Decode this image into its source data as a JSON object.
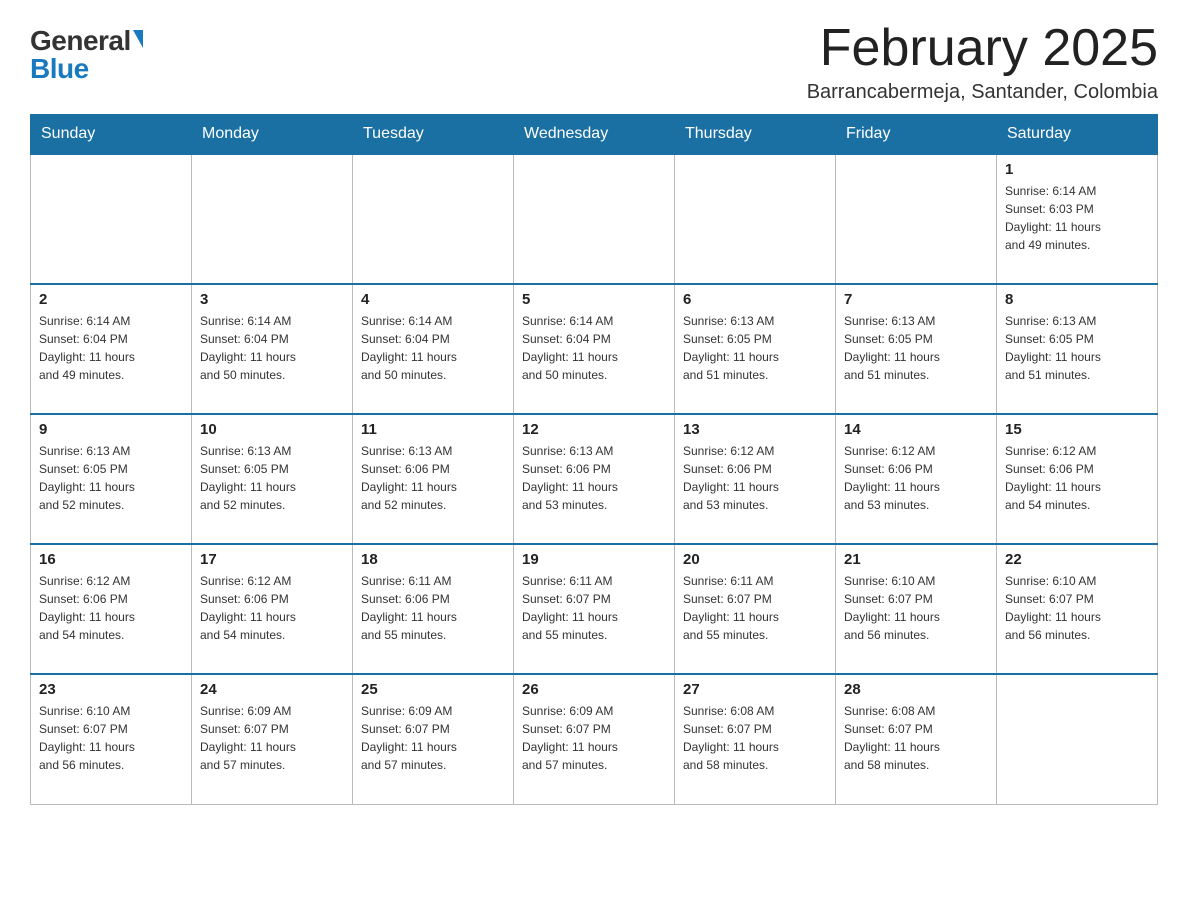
{
  "header": {
    "logo_general": "General",
    "logo_blue": "Blue",
    "title": "February 2025",
    "location": "Barrancabermeja, Santander, Colombia"
  },
  "calendar": {
    "days_of_week": [
      "Sunday",
      "Monday",
      "Tuesday",
      "Wednesday",
      "Thursday",
      "Friday",
      "Saturday"
    ],
    "weeks": [
      [
        {
          "day": "",
          "info": ""
        },
        {
          "day": "",
          "info": ""
        },
        {
          "day": "",
          "info": ""
        },
        {
          "day": "",
          "info": ""
        },
        {
          "day": "",
          "info": ""
        },
        {
          "day": "",
          "info": ""
        },
        {
          "day": "1",
          "info": "Sunrise: 6:14 AM\nSunset: 6:03 PM\nDaylight: 11 hours\nand 49 minutes."
        }
      ],
      [
        {
          "day": "2",
          "info": "Sunrise: 6:14 AM\nSunset: 6:04 PM\nDaylight: 11 hours\nand 49 minutes."
        },
        {
          "day": "3",
          "info": "Sunrise: 6:14 AM\nSunset: 6:04 PM\nDaylight: 11 hours\nand 50 minutes."
        },
        {
          "day": "4",
          "info": "Sunrise: 6:14 AM\nSunset: 6:04 PM\nDaylight: 11 hours\nand 50 minutes."
        },
        {
          "day": "5",
          "info": "Sunrise: 6:14 AM\nSunset: 6:04 PM\nDaylight: 11 hours\nand 50 minutes."
        },
        {
          "day": "6",
          "info": "Sunrise: 6:13 AM\nSunset: 6:05 PM\nDaylight: 11 hours\nand 51 minutes."
        },
        {
          "day": "7",
          "info": "Sunrise: 6:13 AM\nSunset: 6:05 PM\nDaylight: 11 hours\nand 51 minutes."
        },
        {
          "day": "8",
          "info": "Sunrise: 6:13 AM\nSunset: 6:05 PM\nDaylight: 11 hours\nand 51 minutes."
        }
      ],
      [
        {
          "day": "9",
          "info": "Sunrise: 6:13 AM\nSunset: 6:05 PM\nDaylight: 11 hours\nand 52 minutes."
        },
        {
          "day": "10",
          "info": "Sunrise: 6:13 AM\nSunset: 6:05 PM\nDaylight: 11 hours\nand 52 minutes."
        },
        {
          "day": "11",
          "info": "Sunrise: 6:13 AM\nSunset: 6:06 PM\nDaylight: 11 hours\nand 52 minutes."
        },
        {
          "day": "12",
          "info": "Sunrise: 6:13 AM\nSunset: 6:06 PM\nDaylight: 11 hours\nand 53 minutes."
        },
        {
          "day": "13",
          "info": "Sunrise: 6:12 AM\nSunset: 6:06 PM\nDaylight: 11 hours\nand 53 minutes."
        },
        {
          "day": "14",
          "info": "Sunrise: 6:12 AM\nSunset: 6:06 PM\nDaylight: 11 hours\nand 53 minutes."
        },
        {
          "day": "15",
          "info": "Sunrise: 6:12 AM\nSunset: 6:06 PM\nDaylight: 11 hours\nand 54 minutes."
        }
      ],
      [
        {
          "day": "16",
          "info": "Sunrise: 6:12 AM\nSunset: 6:06 PM\nDaylight: 11 hours\nand 54 minutes."
        },
        {
          "day": "17",
          "info": "Sunrise: 6:12 AM\nSunset: 6:06 PM\nDaylight: 11 hours\nand 54 minutes."
        },
        {
          "day": "18",
          "info": "Sunrise: 6:11 AM\nSunset: 6:06 PM\nDaylight: 11 hours\nand 55 minutes."
        },
        {
          "day": "19",
          "info": "Sunrise: 6:11 AM\nSunset: 6:07 PM\nDaylight: 11 hours\nand 55 minutes."
        },
        {
          "day": "20",
          "info": "Sunrise: 6:11 AM\nSunset: 6:07 PM\nDaylight: 11 hours\nand 55 minutes."
        },
        {
          "day": "21",
          "info": "Sunrise: 6:10 AM\nSunset: 6:07 PM\nDaylight: 11 hours\nand 56 minutes."
        },
        {
          "day": "22",
          "info": "Sunrise: 6:10 AM\nSunset: 6:07 PM\nDaylight: 11 hours\nand 56 minutes."
        }
      ],
      [
        {
          "day": "23",
          "info": "Sunrise: 6:10 AM\nSunset: 6:07 PM\nDaylight: 11 hours\nand 56 minutes."
        },
        {
          "day": "24",
          "info": "Sunrise: 6:09 AM\nSunset: 6:07 PM\nDaylight: 11 hours\nand 57 minutes."
        },
        {
          "day": "25",
          "info": "Sunrise: 6:09 AM\nSunset: 6:07 PM\nDaylight: 11 hours\nand 57 minutes."
        },
        {
          "day": "26",
          "info": "Sunrise: 6:09 AM\nSunset: 6:07 PM\nDaylight: 11 hours\nand 57 minutes."
        },
        {
          "day": "27",
          "info": "Sunrise: 6:08 AM\nSunset: 6:07 PM\nDaylight: 11 hours\nand 58 minutes."
        },
        {
          "day": "28",
          "info": "Sunrise: 6:08 AM\nSunset: 6:07 PM\nDaylight: 11 hours\nand 58 minutes."
        },
        {
          "day": "",
          "info": ""
        }
      ]
    ]
  }
}
